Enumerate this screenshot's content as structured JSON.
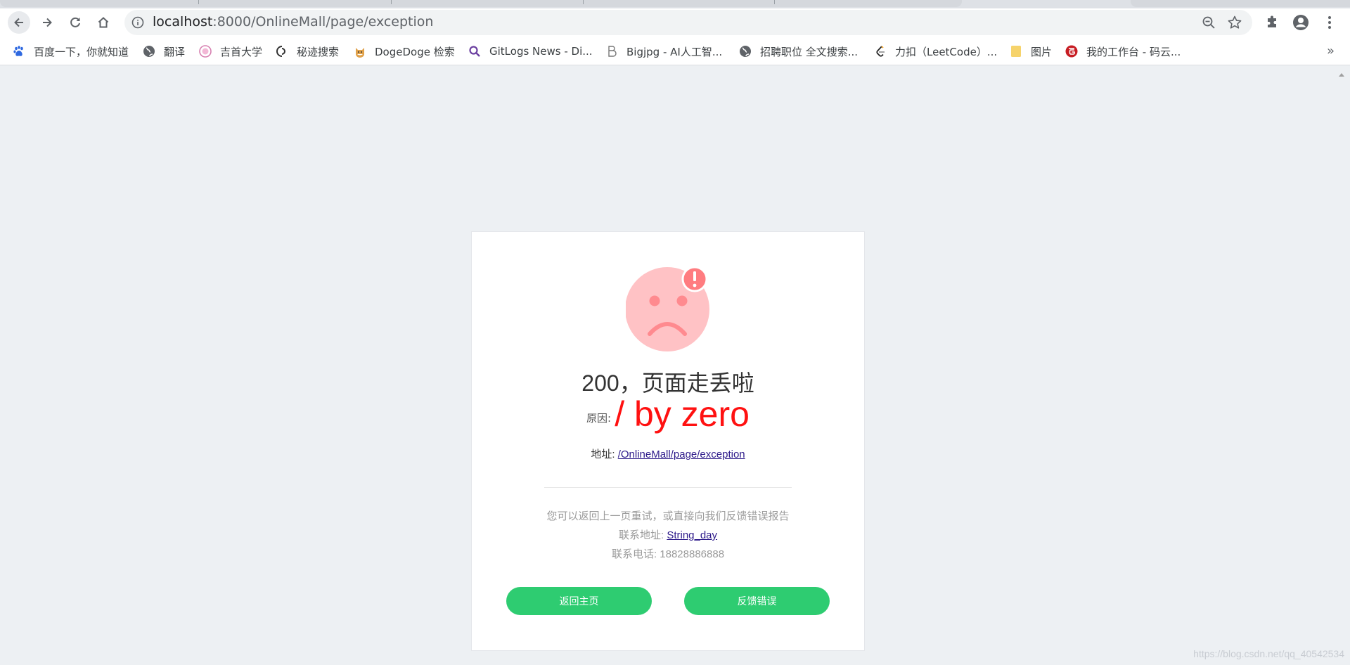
{
  "browser": {
    "url_host": "localhost",
    "url_path": ":8000/OnlineMall/page/exception",
    "bookmarks": [
      {
        "label": "百度一下，你就知道",
        "icon": "paw-icon",
        "color": "#2f69e0"
      },
      {
        "label": "翻译",
        "icon": "globe-icon",
        "color": "#5f6368"
      },
      {
        "label": "吉首大学",
        "icon": "emblem-icon",
        "color": "#d67fb0"
      },
      {
        "label": "秘迹搜索",
        "icon": "mijisou-icon",
        "color": "#333333"
      },
      {
        "label": "DogeDoge 检索",
        "icon": "doge-icon",
        "color": "#e0a14a"
      },
      {
        "label": "GitLogs News - Di...",
        "icon": "magnifier-icon",
        "color": "#6b3fa0"
      },
      {
        "label": "Bigjpg - AI人工智...",
        "icon": "bigjpg-icon",
        "color": "#777777"
      },
      {
        "label": "招聘职位 全文搜索...",
        "icon": "globe-icon",
        "color": "#5f6368"
      },
      {
        "label": "力扣（LeetCode）...",
        "icon": "leetcode-icon",
        "color": "#f0a020"
      },
      {
        "label": "图片",
        "icon": "folder-icon",
        "color": "#f6d36b"
      },
      {
        "label": "我的工作台 - 码云...",
        "icon": "gitee-icon",
        "color": "#c71d23"
      }
    ]
  },
  "error": {
    "title": "200，页面走丢啦",
    "reason_label": "原因:",
    "reason_message": "/ by zero",
    "address_label": "地址:",
    "address_link": "/OnlineMall/page/exception",
    "tip_line": "您可以返回上一页重试，或直接向我们反馈错误报告",
    "contact_label": "联系地址:",
    "contact_link": "String_day",
    "phone_label": "联系电话:",
    "phone_value": "18828886888",
    "home_button": "返回主页",
    "feedback_button": "反馈错误"
  },
  "watermark": "https://blog.csdn.net/qq_40542534",
  "colors": {
    "accent_green": "#2ecc71",
    "error_red": "#ff1111",
    "face_fill": "#ffc2c5",
    "face_features": "#ff8a8f"
  }
}
